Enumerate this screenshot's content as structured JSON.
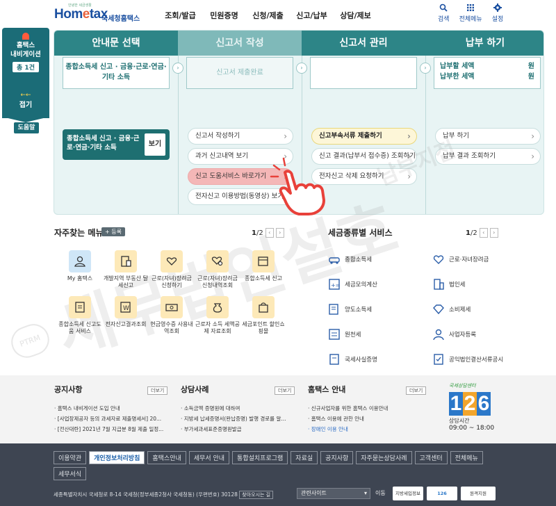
{
  "header": {
    "logo_text_a": "Hom",
    "logo_text_e": "e",
    "logo_text_b": "tax",
    "logo_sub": "국세청홈택스",
    "logo_tiny": "안녕한 세금생활",
    "gnb": [
      "조회/발급",
      "민원증명",
      "신청/제출",
      "신고/납부",
      "상담/제보"
    ],
    "util": [
      {
        "label": "검색",
        "icon": "search-icon"
      },
      {
        "label": "전체메뉴",
        "icon": "grid-icon"
      },
      {
        "label": "설정",
        "icon": "gear-icon"
      }
    ]
  },
  "navi": {
    "title_1": "홈택스",
    "title_2": "내비게이션",
    "count": "총 1건",
    "fold_arrow": "←←",
    "fold_label": "접기",
    "help": "도움말"
  },
  "panel": {
    "col1": {
      "title": "안내문 선택",
      "box": "종합소득세 신고 · 금융·근로·연금·기타 소득",
      "card": "종합소득세 신고 · 금융·근로·연금·기타 소득",
      "card_btn": "보기"
    },
    "col2": {
      "title": "신고서 작성",
      "box": "신고서 제출완료",
      "items": [
        "신고서 작성하기",
        "과거 신고내역 보기",
        "신고 도움서비스 바로가기",
        "전자신고 이용방법(동영상) 보기"
      ]
    },
    "col3": {
      "title": "신고서 관리",
      "items": [
        "신고부속서류 제출하기",
        "신고 결과(납부서 접수증) 조회하기",
        "전자신고 삭제 요청하기"
      ]
    },
    "col4": {
      "title": "납부 하기",
      "row1_label": "납부할 세액",
      "row1_unit": "원",
      "row2_label": "납부한 세액",
      "row2_unit": "원",
      "items": [
        "납부 하기",
        "납부 결과 조회하기"
      ]
    }
  },
  "favorites": {
    "title": "자주찾는 메뉴",
    "add": "+ 등록",
    "page": "1",
    "total": "/2",
    "items": [
      "My 홈택스",
      "개발지역 부동산 탈세신고",
      "근로(자녀)장려금 신청하기",
      "근로(자녀)장려금 신청내역조회",
      "종합소득세 신고",
      "종합소득세 신고도움 서비스",
      "전자신고결과조회",
      "현금영수증 사용내역조회",
      "근로자 소득 세액공제 자료조회",
      "세금포인트 할인쇼핑몰"
    ]
  },
  "taxservice": {
    "title": "세금종류별 서비스",
    "page": "1",
    "total": "/2",
    "items": [
      "종합소득세",
      "근로·자녀장려금",
      "세금모의계산",
      "법인세",
      "양도소득세",
      "소비제세",
      "원천세",
      "사업자등록",
      "국세사실증명",
      "공익법인결산서류공시"
    ]
  },
  "notice": {
    "col1": {
      "title": "공지사항",
      "more": "더보기",
      "items": [
        "홈택스 내비게이션 도입 안내",
        "[사업장제공자 등의 과세자료 제출명세서] 20...",
        "[전산대란] 2021년 7월 지급분 8월 제출 일정..."
      ]
    },
    "col2": {
      "title": "상담사례",
      "more": "더보기",
      "items": [
        "소득금액 증명원에 대하여",
        "지방세 납세증명서(완납증명) 발행 경로를 알...",
        "부가세과세표준증명원발급"
      ]
    },
    "col3": {
      "title": "홈택스 안내",
      "more": "더보기",
      "items": [
        "신규사업자를 위한 홈택스 이용안내",
        "홈택스 이용에 관한 안내",
        "장애인 이용 안내"
      ]
    },
    "callcenter": {
      "tag": "국세상담센터",
      "digits": [
        "1",
        "2",
        "6"
      ],
      "time_label": "상담시간",
      "hours": "09:00 ~ 18:00"
    }
  },
  "footer": {
    "links": [
      "이용약관",
      "개인정보처리방침",
      "홈택스안내",
      "세무서 안내",
      "통합설치프로그램",
      "자료실",
      "공지사항",
      "자주묻는상담사례",
      "고객센터",
      "전체메뉴",
      "세무서식"
    ],
    "address": "세종특별자치시 국세청로 8-14 국세청(정부세종2청사 국세청동) (우편번호) 30128",
    "directions": "찾아오시는 길",
    "select": "관련사이트",
    "go": "이동",
    "badges": [
      "지방세입정보",
      "126",
      "원격지원"
    ]
  },
  "watermark": {
    "text1": "세무법인설호",
    "text2": "남부지점",
    "seal": "PTRM"
  },
  "colors": {
    "teal": "#1e6f71",
    "teal_head": "#2d8587",
    "footer_bg": "#3e4552",
    "brand_blue": "#1a4fa0"
  }
}
